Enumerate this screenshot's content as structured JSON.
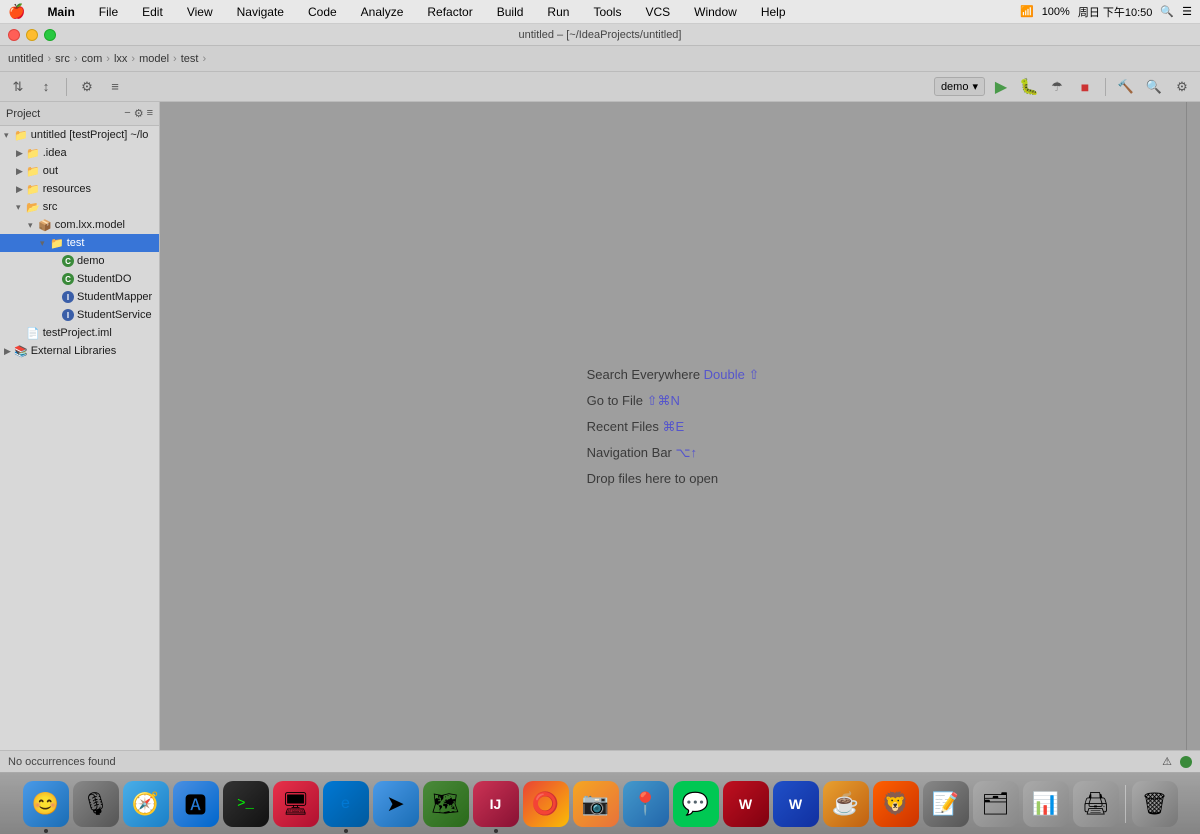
{
  "menubar": {
    "apple": "🍎",
    "items": [
      "Main",
      "File",
      "Edit",
      "View",
      "Navigate",
      "Code",
      "Analyze",
      "Refactor",
      "Build",
      "Run",
      "Tools",
      "VCS",
      "Window",
      "Help"
    ],
    "right": "周日 下午10:50",
    "battery": "100%"
  },
  "titlebar": {
    "title": "untitled – [~/IdeaProjects/untitled]"
  },
  "breadcrumb": {
    "items": [
      "untitled",
      "src",
      "com",
      "lxx",
      "model",
      "test"
    ]
  },
  "sidebar": {
    "label": "Project",
    "tree": [
      {
        "label": "untitled [testProject]  ~/lo",
        "indent": 0,
        "type": "project",
        "expanded": true
      },
      {
        "label": ".idea",
        "indent": 1,
        "type": "folder"
      },
      {
        "label": "out",
        "indent": 1,
        "type": "folder"
      },
      {
        "label": "resources",
        "indent": 1,
        "type": "folder"
      },
      {
        "label": "src",
        "indent": 1,
        "type": "src",
        "expanded": true
      },
      {
        "label": "com.lxx.model",
        "indent": 2,
        "type": "package",
        "expanded": true
      },
      {
        "label": "test",
        "indent": 3,
        "type": "folder",
        "selected": true
      },
      {
        "label": "demo",
        "indent": 4,
        "type": "class-c"
      },
      {
        "label": "StudentDO",
        "indent": 4,
        "type": "class-c"
      },
      {
        "label": "StudentMapper",
        "indent": 4,
        "type": "interface-i"
      },
      {
        "label": "StudentService",
        "indent": 4,
        "type": "interface-i"
      },
      {
        "label": "testProject.iml",
        "indent": 1,
        "type": "iml"
      },
      {
        "label": "External Libraries",
        "indent": 0,
        "type": "libs"
      }
    ]
  },
  "editor": {
    "hints": [
      {
        "text": "Search Everywhere",
        "shortcut": "Double ⇧",
        "shortcut_only": false
      },
      {
        "text": "Go to File",
        "shortcut": "⇧⌘N",
        "shortcut_only": false
      },
      {
        "text": "Recent Files",
        "shortcut": "⌘E",
        "shortcut_only": false
      },
      {
        "text": "Navigation Bar",
        "shortcut": "⌥↑",
        "shortcut_only": false
      },
      {
        "text": "Drop files here to open",
        "shortcut": null
      }
    ]
  },
  "toolbar": {
    "run_config": "demo",
    "buttons": [
      "⬆",
      "⬇",
      "⚙",
      "≡"
    ]
  },
  "statusbar": {
    "message": "No occurrences found"
  }
}
